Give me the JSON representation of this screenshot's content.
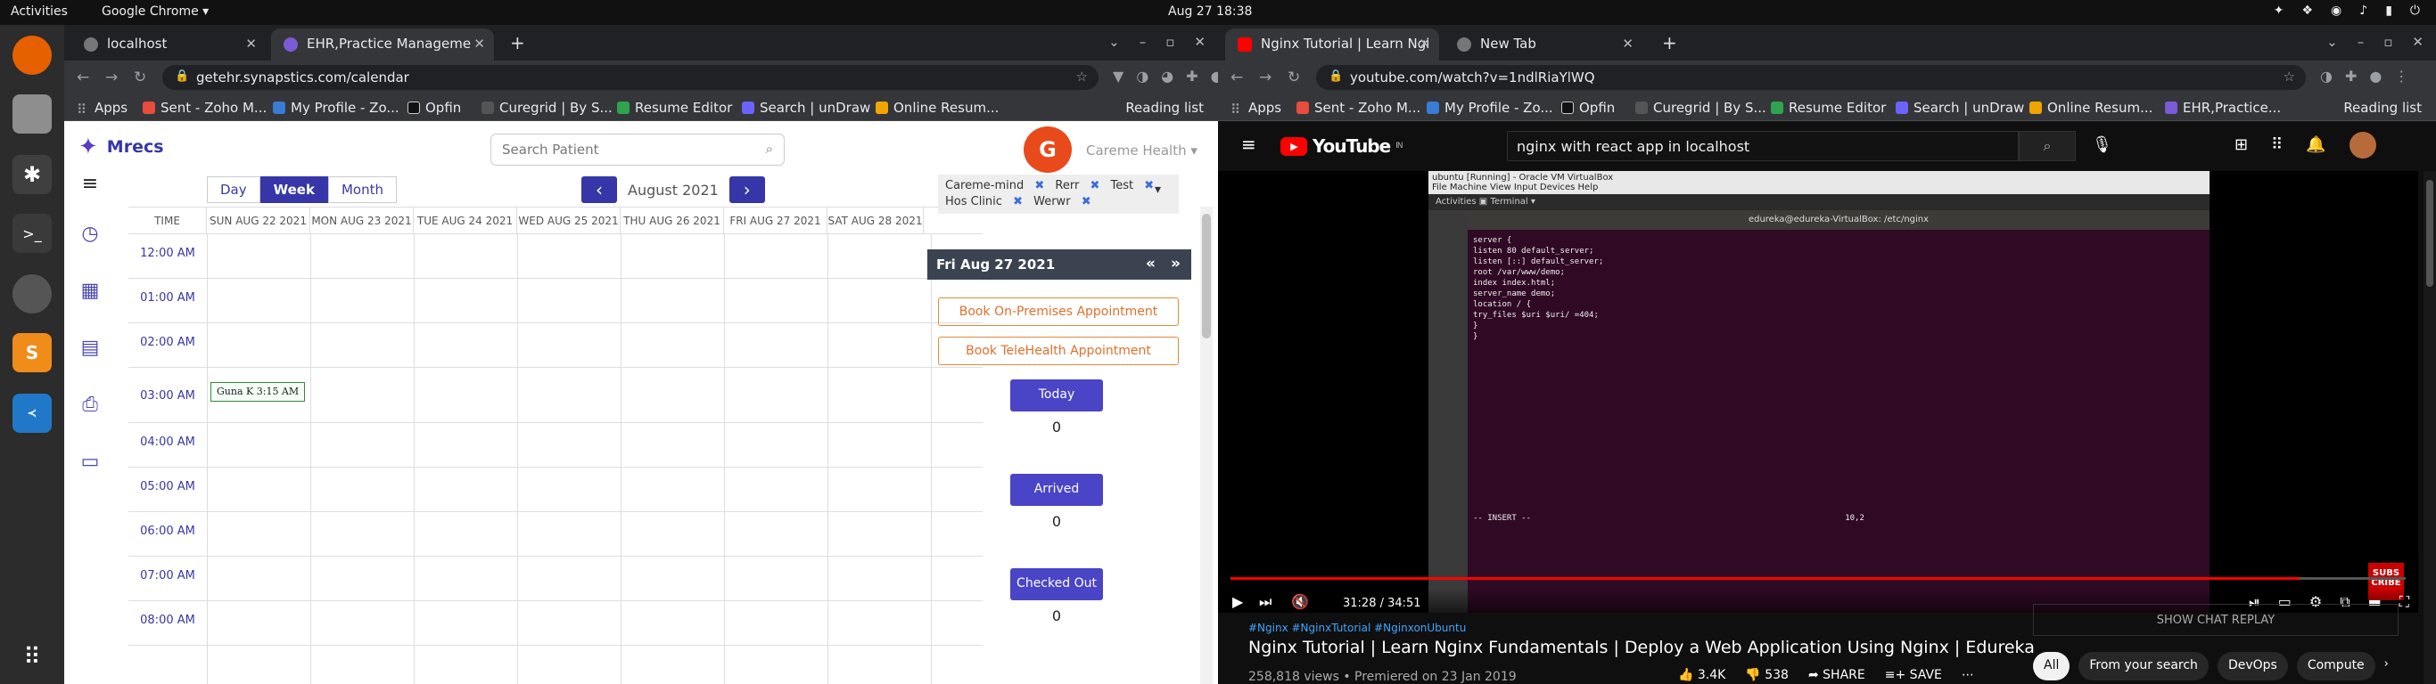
{
  "topbar": {
    "activities": "Activities",
    "app": "Google Chrome ▾",
    "clock": "Aug 27  18:38"
  },
  "left": {
    "tabs": [
      {
        "title": "localhost"
      },
      {
        "title": "EHR,Practice Manageme"
      }
    ],
    "url": "getehr.synapstics.com/calendar",
    "bookmarks": [
      "Apps",
      "Sent - Zoho M...",
      "My Profile - Zo...",
      "Opfin",
      "Curegrid | By S...",
      "Resume Editor",
      "Search | unDraw",
      "Online Resum..."
    ],
    "reading_list": "Reading list",
    "app_name": "Mrecs",
    "search_placeholder": "Search Patient",
    "brand_name": "Careme Health",
    "view_buttons": [
      "Day",
      "Week",
      "Month"
    ],
    "month_label": "August 2021",
    "calendar": {
      "columns": [
        "TIME",
        "SUN AUG 22 2021",
        "MON AUG 23 2021",
        "TUE AUG 24 2021",
        "WED AUG 25 2021",
        "THU AUG 26 2021",
        "FRI AUG 27 2021",
        "SAT AUG 28 2021"
      ],
      "times": [
        "12:00 AM",
        "01:00 AM",
        "02:00 AM",
        "03:00 AM",
        "04:00 AM",
        "05:00 AM",
        "06:00 AM",
        "07:00 AM",
        "08:00 AM"
      ],
      "appointment": {
        "name": "Guna K",
        "time": "3:15 AM"
      }
    },
    "filters": {
      "items": [
        "Careme-mind",
        "Rerr",
        "Test",
        "Hos Clinic",
        "Werwr"
      ]
    },
    "date_header": "Fri Aug 27 2021",
    "book_onprem": "Book On-Premises Appointment",
    "book_tele": "Book TeleHealth Appointment",
    "stats": [
      {
        "label": "Today",
        "value": "0"
      },
      {
        "label": "Arrived",
        "value": "0"
      },
      {
        "label": "Checked Out",
        "value": "0"
      }
    ]
  },
  "right": {
    "tabs": [
      {
        "title": "Nginx Tutorial | Learn Ngi"
      },
      {
        "title": "New Tab"
      }
    ],
    "url": "youtube.com/watch?v=1ndlRiaYlWQ",
    "bookmarks": [
      "Apps",
      "Sent - Zoho M...",
      "My Profile - Zo...",
      "Opfin",
      "Curegrid | By S...",
      "Resume Editor",
      "Search | unDraw",
      "Online Resum...",
      "EHR,Practice..."
    ],
    "reading_list": "Reading list",
    "yt_logo": "YouTube",
    "yt_region": "IN",
    "search_value": "nginx with react app in localhost",
    "vm_title": "ubuntu [Running] - Oracle VM VirtualBox",
    "vm_menu": "File  Machine  View  Input  Devices  Help",
    "vm_activities": "Activities      ▣ Terminal ▾",
    "term_title": "edureka@edureka-VirtualBox: /etc/nginx",
    "term_lines": "server {\nlisten 80 default_server;\nlisten [::] default_server;\nroot /var/www/demo;\nindex index.html;\nserver_name demo;\nlocation / {\ntry_files $uri $uri/ =404;\n}\n}\n\n\n\n\n\n\n\n\n\n\n\n\n\n\n\n\n-- INSERT --                                                                 10,2",
    "subscribe_badge": "SUBS CRIBE",
    "time": "31:28 / 34:51",
    "progress": 0.91,
    "tags": "#Nginx #NginxTutorial #NginxonUbuntu",
    "title": "Nginx Tutorial | Learn Nginx Fundamentals | Deploy a Web Application Using Nginx | Edureka",
    "meta": "258,818 views • Premiered on 23 Jan 2019",
    "likes": "3.4K",
    "dislikes": "538",
    "share": "SHARE",
    "save": "SAVE",
    "chat_replay": "SHOW CHAT REPLAY",
    "chips": [
      "All",
      "From your search",
      "DevOps",
      "Compute"
    ]
  }
}
